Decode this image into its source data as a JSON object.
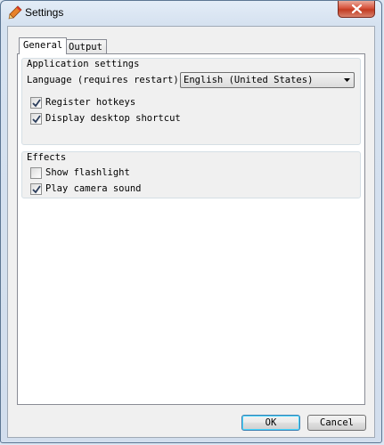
{
  "window": {
    "title": "Settings",
    "close_icon": "close-icon"
  },
  "tabs": [
    {
      "label": "General",
      "selected": true
    },
    {
      "label": "Output",
      "selected": false
    }
  ],
  "general": {
    "app_group": {
      "title": "Application settings",
      "language_label": "Language (requires restart)",
      "language_value": "English (United States)",
      "checkboxes": [
        {
          "label": "Register hotkeys",
          "checked": true
        },
        {
          "label": "Display desktop shortcut",
          "checked": true
        }
      ]
    },
    "effects_group": {
      "title": "Effects",
      "checkboxes": [
        {
          "label": "Show flashlight",
          "checked": false
        },
        {
          "label": "Play camera sound",
          "checked": true
        }
      ]
    }
  },
  "buttons": {
    "ok": "OK",
    "cancel": "Cancel"
  },
  "colors": {
    "accent": "#3c7fb1",
    "close": "#c23c22"
  }
}
